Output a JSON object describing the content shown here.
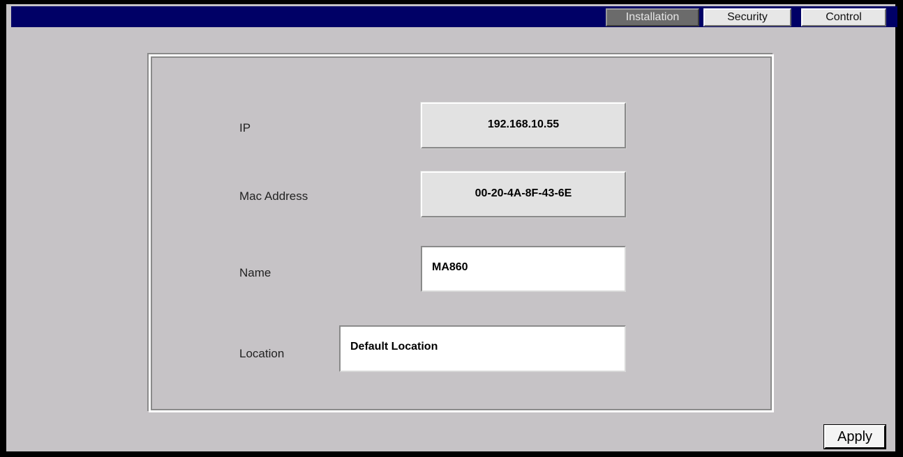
{
  "tabs": [
    {
      "label": "Installation",
      "active": true
    },
    {
      "label": "Security",
      "active": false
    },
    {
      "label": "Control",
      "active": false
    }
  ],
  "form": {
    "ip": {
      "label": "IP",
      "value": "192.168.10.55"
    },
    "mac": {
      "label": "Mac Address",
      "value": "00-20-4A-8F-43-6E"
    },
    "name": {
      "label": "Name",
      "value": "MA860"
    },
    "location": {
      "label": "Location",
      "value": "Default Location"
    }
  },
  "actions": {
    "apply_label": "Apply"
  },
  "colors": {
    "topbar": "#000066",
    "background": "#c6c3c6",
    "active_tab": "#6b6b6b"
  }
}
